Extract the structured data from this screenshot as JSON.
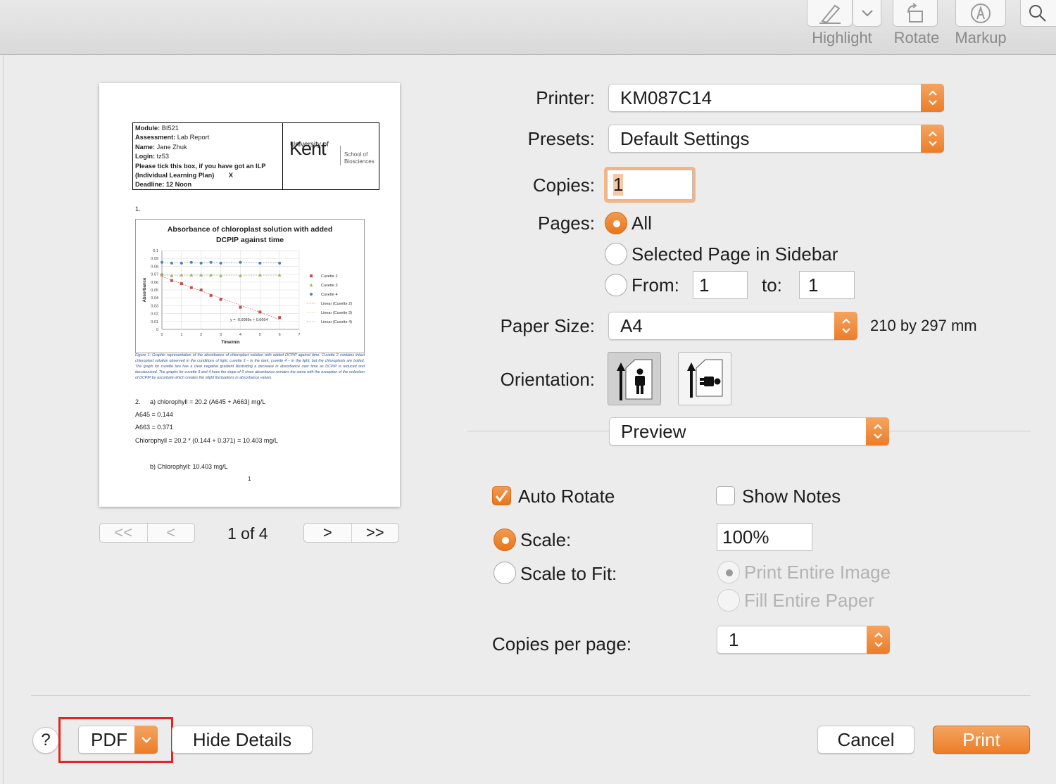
{
  "toolbar": {
    "highlight_label": "Highlight",
    "rotate_label": "Rotate",
    "markup_label": "Markup"
  },
  "preview": {
    "info": {
      "module_key": "Module:",
      "module_val": "BI521",
      "assessment_key": "Assessment:",
      "assessment_val": "Lab Report",
      "name_key": "Name:",
      "name_val": "Jane Zhuk",
      "login_key": "Login:",
      "login_val": "tz53",
      "ilp_line1": "Please tick this box, if you have got an ILP",
      "ilp_line2": "(Individual Learning Plan)",
      "ilp_mark": "X",
      "deadline": "Deadline: 12 Noon",
      "logo_top": "University of",
      "logo_main": "Kent",
      "logo_school": "School of",
      "logo_dept": "Biosciences"
    },
    "q1": "1.",
    "caption": "Figure 1: Graphic representation of the absorbance of chloroplast solution with added DCPIP against time. Cuvette 2 contains intact chloroplast solution observed in the conditions of light, cuvette 3 – in the dark, cuvette 4 – in the light, but the chloroplasts are boiled. The graph for cuvette two has a clear negative gradient illustrating a decrease in absorbance over time as DCPIP is reduced and decolourised. The graphs for cuvette 3 and 4 have the slope of 0 since absorbance remains the same with the exception of the reduction of DCPIP by ascorbate which creates the slight fluctuations in absorbance values.",
    "q2_num": "2.",
    "q2_a": "a) chlorophyll = 20.2 (A645 + A663) mg/L",
    "a645": "A645 = 0.144",
    "a663": "A663 = 0.371",
    "chl_calc": "Chlorophyll = 20.2 * (0.144 + 0.371) = 10.403 mg/L",
    "q2_b": "b)  Chlorophyll: 10.403 mg/L",
    "page_num": "1"
  },
  "chart_data": {
    "type": "scatter",
    "title": "Absorbance of chloroplast solution with added DCPIP against time",
    "xlabel": "Time/min",
    "ylabel": "Absorbance",
    "xlim": [
      0,
      7
    ],
    "ylim": [
      0,
      0.1
    ],
    "x_ticks": [
      "0",
      "1",
      "2",
      "3",
      "4",
      "5",
      "6",
      "7"
    ],
    "y_ticks": [
      "0",
      "0.01",
      "0.02",
      "0.03",
      "0.04",
      "0.05",
      "0.06",
      "0.07",
      "0.08",
      "0.09",
      "0.1"
    ],
    "grid": true,
    "legend_position": "right",
    "series": [
      {
        "name": "Cuvette 2",
        "color": "#c0504d",
        "marker": "square",
        "x": [
          0,
          0.5,
          1,
          1.5,
          2,
          2.5,
          3,
          4,
          5,
          6
        ],
        "y": [
          0.069,
          0.062,
          0.058,
          0.053,
          0.05,
          0.043,
          0.038,
          0.028,
          0.022,
          0.015
        ]
      },
      {
        "name": "Cuvette 3",
        "color": "#9bbb59",
        "marker": "triangle",
        "x": [
          0,
          0.5,
          1,
          1.5,
          2,
          2.5,
          3,
          4,
          5,
          6
        ],
        "y": [
          0.069,
          0.068,
          0.069,
          0.069,
          0.069,
          0.069,
          0.068,
          0.068,
          0.069,
          0.069
        ]
      },
      {
        "name": "Cuvette 4",
        "color": "#4f81bd",
        "marker": "circle",
        "x": [
          0,
          0.5,
          1,
          1.5,
          2,
          2.5,
          3,
          4,
          5,
          6
        ],
        "y": [
          0.085,
          0.084,
          0.084,
          0.085,
          0.084,
          0.085,
          0.084,
          0.085,
          0.084,
          0.084
        ]
      }
    ],
    "trendline_labels": [
      "Linear (Cuvette 2)",
      "Linear (Cuvette 3)",
      "Linear (Cuvette 4)"
    ],
    "annotation": "y = -0.0089x + 0.0664"
  },
  "pager": {
    "first": "<<",
    "prev": "<",
    "page_status": "1 of 4",
    "next": ">",
    "last": ">>"
  },
  "form": {
    "printer_label": "Printer:",
    "printer_value": "KM087C14",
    "presets_label": "Presets:",
    "presets_value": "Default Settings",
    "copies_label": "Copies:",
    "copies_value": "1",
    "pages_label": "Pages:",
    "pages_all": "All",
    "pages_selected": "Selected Page in Sidebar",
    "pages_from": "From:",
    "from_value": "1",
    "pages_to": "to:",
    "to_value": "1",
    "paper_label": "Paper Size:",
    "paper_value": "A4",
    "paper_dims": "210 by 297 mm",
    "orientation_label": "Orientation:",
    "app_menu": "Preview",
    "auto_rotate": "Auto Rotate",
    "show_notes": "Show Notes",
    "scale_label": "Scale:",
    "scale_value": "100%",
    "scale_to_fit": "Scale to Fit:",
    "print_entire": "Print Entire Image",
    "fill_entire": "Fill Entire Paper",
    "copies_per_page_label": "Copies per page:",
    "copies_per_page_value": "1"
  },
  "footer": {
    "help": "?",
    "pdf": "PDF",
    "hide_details": "Hide Details",
    "cancel": "Cancel",
    "print": "Print"
  },
  "colors": {
    "accent": "#ec7d28",
    "highlight_box": "#e8231f"
  }
}
